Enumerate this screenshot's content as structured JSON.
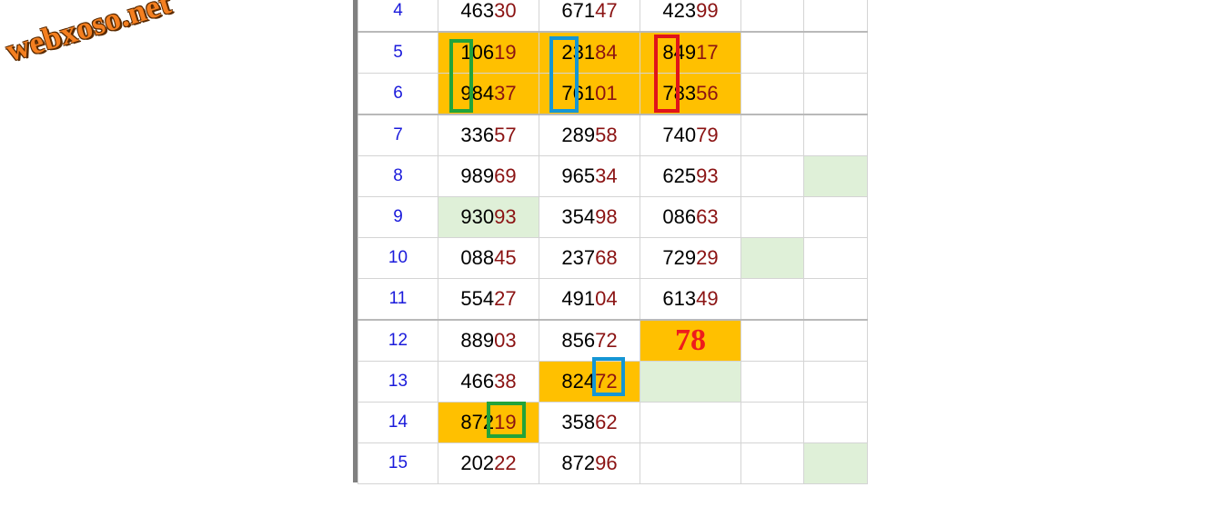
{
  "watermark": "webxoso.net",
  "rows": [
    {
      "n": "4",
      "a": [
        "463",
        "30"
      ],
      "b": [
        "671",
        "47"
      ],
      "c": [
        "423",
        "99"
      ]
    },
    {
      "n": "5",
      "a": [
        "106",
        "19"
      ],
      "b": [
        "231",
        "84"
      ],
      "c": [
        "849",
        "17"
      ]
    },
    {
      "n": "6",
      "a": [
        "984",
        "37"
      ],
      "b": [
        "761",
        "01"
      ],
      "c": [
        "783",
        "56"
      ]
    },
    {
      "n": "7",
      "a": [
        "336",
        "57"
      ],
      "b": [
        "289",
        "58"
      ],
      "c": [
        "740",
        "79"
      ]
    },
    {
      "n": "8",
      "a": [
        "989",
        "69"
      ],
      "b": [
        "965",
        "34"
      ],
      "c": [
        "625",
        "93"
      ]
    },
    {
      "n": "9",
      "a": [
        "930",
        "93"
      ],
      "b": [
        "354",
        "98"
      ],
      "c": [
        "086",
        "63"
      ]
    },
    {
      "n": "10",
      "a": [
        "088",
        "45"
      ],
      "b": [
        "237",
        "68"
      ],
      "c": [
        "729",
        "29"
      ]
    },
    {
      "n": "11",
      "a": [
        "554",
        "27"
      ],
      "b": [
        "491",
        "04"
      ],
      "c": [
        "613",
        "49"
      ]
    },
    {
      "n": "12",
      "a": [
        "889",
        "03"
      ],
      "b": [
        "856",
        "72"
      ],
      "c": "78"
    },
    {
      "n": "13",
      "a": [
        "466",
        "38"
      ],
      "b": [
        "824",
        "72"
      ]
    },
    {
      "n": "14",
      "a": [
        "872",
        "19"
      ],
      "b": [
        "358",
        "62"
      ]
    },
    {
      "n": "15",
      "a": [
        "202",
        "22"
      ],
      "b": [
        "872",
        "96"
      ]
    }
  ],
  "colors": {
    "highlight": "#ffc000",
    "hit": "#dff0d8",
    "row_number": "#1a1adb",
    "tail_digits": "#8b1313",
    "prediction": "#ee1c1c",
    "frame_green": "#22a33a",
    "frame_blue": "#1596d4",
    "frame_red": "#e0141a",
    "watermark": "#f47f20"
  }
}
